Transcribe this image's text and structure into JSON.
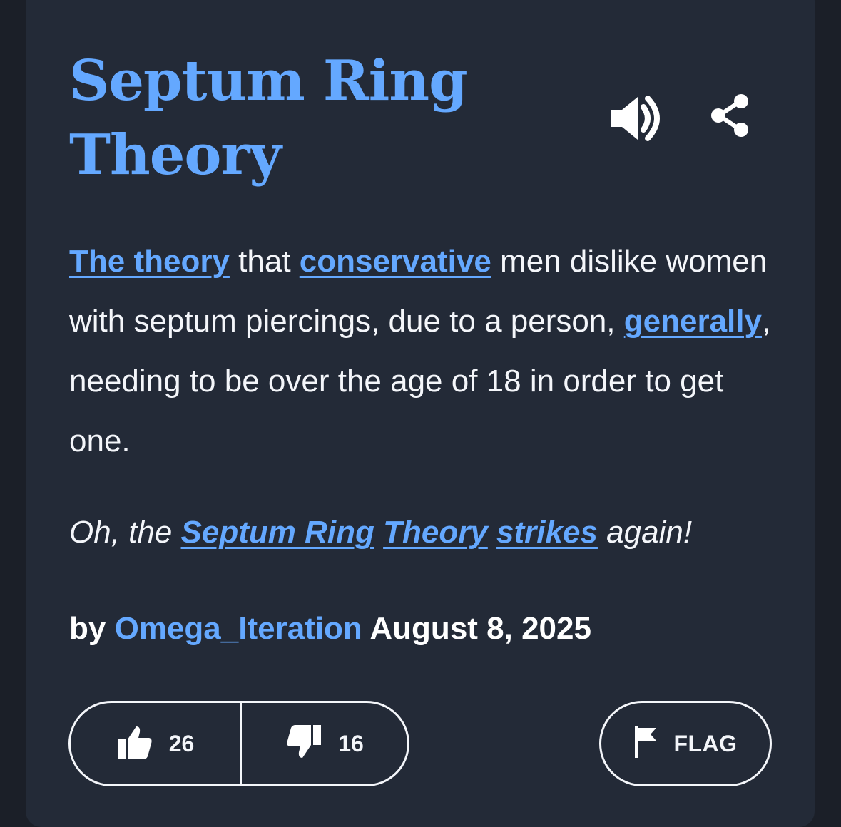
{
  "definition": {
    "title": "Septum Ring Theory",
    "meaning": [
      {
        "text": "The theory",
        "link": true
      },
      {
        "text": " that ",
        "link": false
      },
      {
        "text": "conservative",
        "link": true
      },
      {
        "text": " men dislike women with septum piercings, due to a person, ",
        "link": false
      },
      {
        "text": "generally",
        "link": true
      },
      {
        "text": ", needing to be over the age of 18 in order to get one.",
        "link": false
      }
    ],
    "example": [
      {
        "text": "Oh, the ",
        "link": false
      },
      {
        "text": "Septum Ring",
        "link": true
      },
      {
        "text": " ",
        "link": false
      },
      {
        "text": "Theory",
        "link": true
      },
      {
        "text": " ",
        "link": false
      },
      {
        "text": "strikes",
        "link": true
      },
      {
        "text": " again!",
        "link": false
      }
    ],
    "byline": {
      "prefix": "by",
      "author": "Omega_Iteration",
      "date": "August 8, 2025"
    },
    "votes": {
      "up": "26",
      "down": "16"
    },
    "flag_label": "FLAG"
  },
  "icons": {
    "speaker": "speaker-icon",
    "share": "share-icon",
    "thumbs_up": "thumbs-up-icon",
    "thumbs_down": "thumbs-down-icon",
    "flag": "flag-icon"
  },
  "colors": {
    "background": "#1b1f28",
    "card": "#232a37",
    "accent": "#64a8ff",
    "text": "#f4f6fa"
  }
}
